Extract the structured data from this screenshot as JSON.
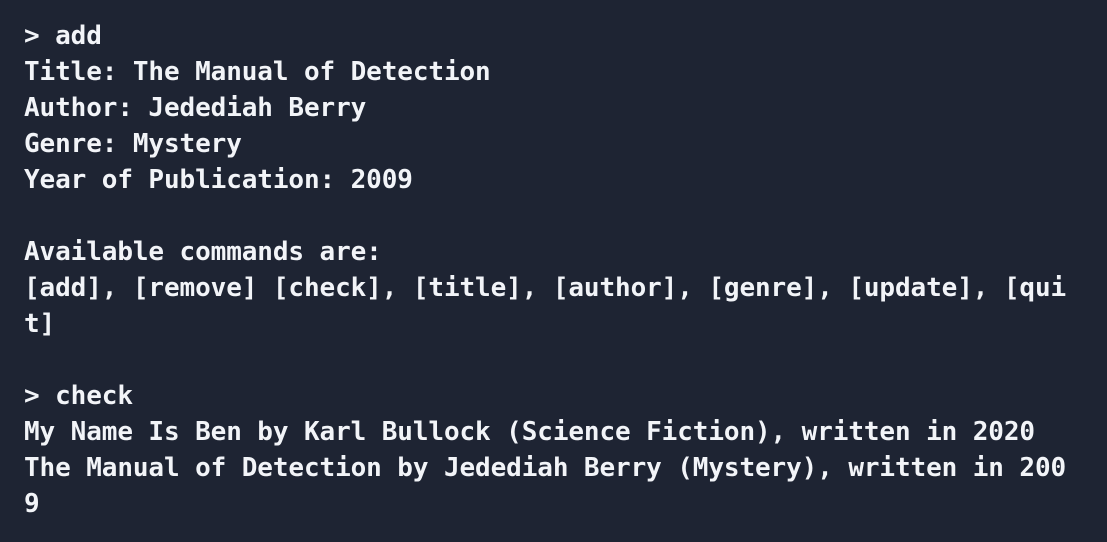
{
  "terminal": {
    "lines": [
      "> add",
      "Title: The Manual of Detection",
      "Author: Jedediah Berry",
      "Genre: Mystery",
      "Year of Publication: 2009",
      "",
      "Available commands are:",
      "[add], [remove] [check], [title], [author], [genre], [update], [qui",
      "t]",
      "",
      "> check",
      "My Name Is Ben by Karl Bullock (Science Fiction), written in 2020",
      "The Manual of Detection by Jedediah Berry (Mystery), written in 200",
      "9"
    ]
  },
  "colors": {
    "background": "#1e2433",
    "text": "#f2f4f8"
  }
}
